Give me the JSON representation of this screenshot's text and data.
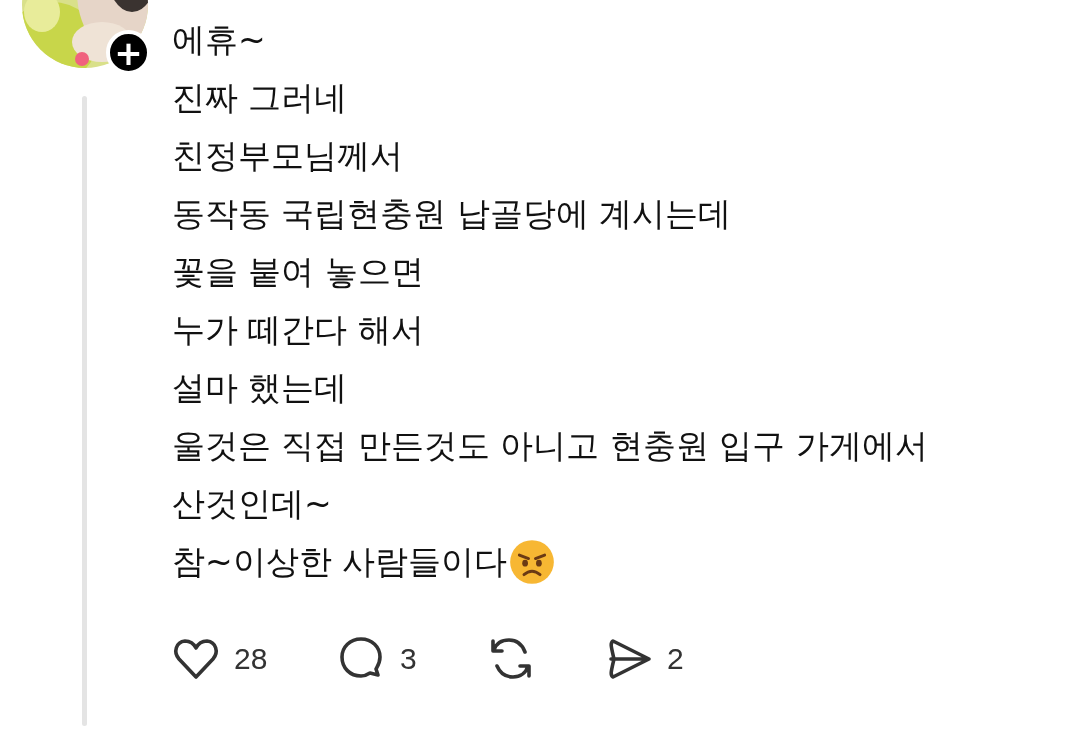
{
  "post": {
    "follow_badge": "+",
    "lines": [
      "에휴~",
      "진짜 그러네",
      "친정부모님께서",
      "동작동 국립현충원 납골당에 계시는데",
      "꽃을 붙여 놓으면",
      "누가 떼간다 해서",
      "설마 했는데",
      "울것은 직접 만든것도 아니고 현충원 입구 가게에서",
      "산것인데~",
      "참~이상한 사람들이다"
    ],
    "trailing_icon": {
      "kind": "angry"
    },
    "actions": [
      {
        "kind": "like",
        "count": "28"
      },
      {
        "kind": "reply",
        "count": "3"
      },
      {
        "kind": "repost"
      },
      {
        "kind": "share",
        "count": "2"
      }
    ]
  }
}
